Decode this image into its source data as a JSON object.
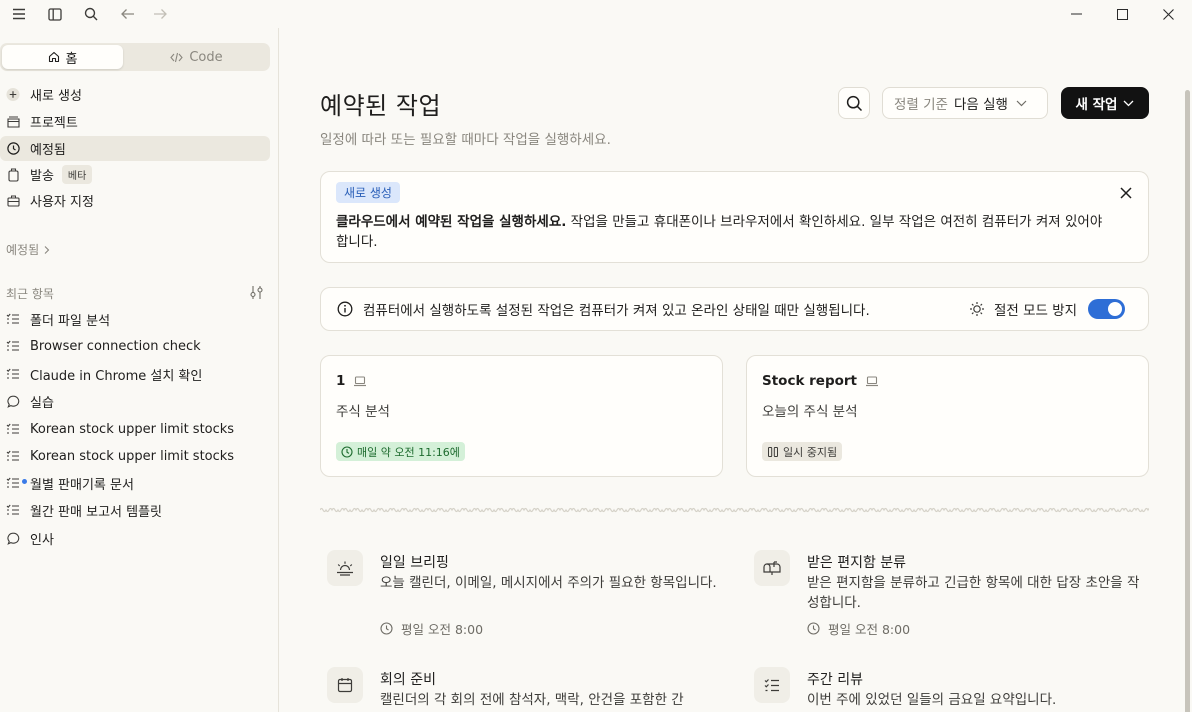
{
  "titlebar": {
    "icons": [
      "menu-icon",
      "sidebar-toggle-icon",
      "search-icon",
      "back-arrow-icon",
      "forward-arrow-icon"
    ],
    "window_controls": [
      "minimize-icon",
      "maximize-icon",
      "close-icon"
    ]
  },
  "sidebar": {
    "mode_tabs": [
      {
        "label": "홈",
        "icon": "home-icon",
        "active": true
      },
      {
        "label": "Code",
        "icon": "code-icon",
        "active": false
      }
    ],
    "nav": [
      {
        "label": "새로 생성",
        "icon": "plus-circle-icon"
      },
      {
        "label": "프로젝트",
        "icon": "folder-icon"
      },
      {
        "label": "예정됨",
        "icon": "clock-icon",
        "active": true
      },
      {
        "label": "발송",
        "icon": "package-icon",
        "badge": "베타"
      },
      {
        "label": "사용자 지정",
        "icon": "briefcase-icon"
      }
    ],
    "scheduled_label": "예정됨",
    "recent_label": "최근 항목",
    "recent": [
      {
        "label": "폴더 파일 분석",
        "icon": "task-list-icon"
      },
      {
        "label": "Browser connection check",
        "icon": "task-list-icon"
      },
      {
        "label": "Claude in Chrome 설치 확인",
        "icon": "task-list-icon"
      },
      {
        "label": "실습",
        "icon": "chat-bubble-icon"
      },
      {
        "label": "Korean stock upper limit stocks",
        "icon": "task-list-icon"
      },
      {
        "label": "Korean stock upper limit stocks",
        "icon": "task-list-icon"
      },
      {
        "label": "월별 판매기록 문서",
        "icon": "task-list-icon",
        "unread": true
      },
      {
        "label": "월간 판매 보고서 템플릿",
        "icon": "task-list-icon"
      },
      {
        "label": "인사",
        "icon": "chat-bubble-icon"
      }
    ]
  },
  "header": {
    "title": "예약된 작업",
    "subtitle": "일정에 따라 또는 필요할 때마다 작업을 실행하세요.",
    "sort_prefix": "정렬 기준",
    "sort_value": "다음 실행",
    "new_task": "새 작업"
  },
  "banner": {
    "badge": "새로 생성",
    "bold": "클라우드에서 예약된 작업을 실행하세요.",
    "text": " 작업을 만들고 휴대폰이나 브라우저에서 확인하세요. 일부 작업은 여전히 컴퓨터가 켜져 있어야 합니다."
  },
  "info": {
    "text": "컴퓨터에서 실행하도록 설정된 작업은 컴퓨터가 켜져 있고 온라인 상태일 때만 실행됩니다.",
    "sleep_label": "절전 모드 방지",
    "sleep_enabled": true
  },
  "tasks": [
    {
      "title": "1",
      "desc": "주식 분석",
      "status": "매일 약 오전 11:16에",
      "status_type": "scheduled"
    },
    {
      "title": "Stock report",
      "desc": "오늘의 주식 분석",
      "status": "일시 중지됨",
      "status_type": "paused"
    }
  ],
  "templates": [
    {
      "title": "일일 브리핑",
      "desc": "오늘 캘린더, 이메일, 메시지에서 주의가 필요한 항목입니다.",
      "time": "평일 오전 8:00",
      "icon": "sunrise-icon"
    },
    {
      "title": "받은 편지함 분류",
      "desc": "받은 편지함을 분류하고 긴급한 항목에 대한 답장 초안을 작성합니다.",
      "time": "평일 오전 8:00",
      "icon": "mailbox-icon"
    },
    {
      "title": "회의 준비",
      "desc": "캘린더의 각 회의 전에 참석자, 맥락, 안건을 포함한 간",
      "time": "",
      "icon": "calendar-icon"
    },
    {
      "title": "주간 리뷰",
      "desc": "이번 주에 있었던 일들의 금요일 요약입니다.",
      "time": "",
      "icon": "checklist-icon"
    }
  ],
  "colors": {
    "background": "#faf9f5",
    "accent_blue": "#2e6ed6",
    "scheduled_green": "#d4f0d8",
    "primary_button": "#121212"
  }
}
